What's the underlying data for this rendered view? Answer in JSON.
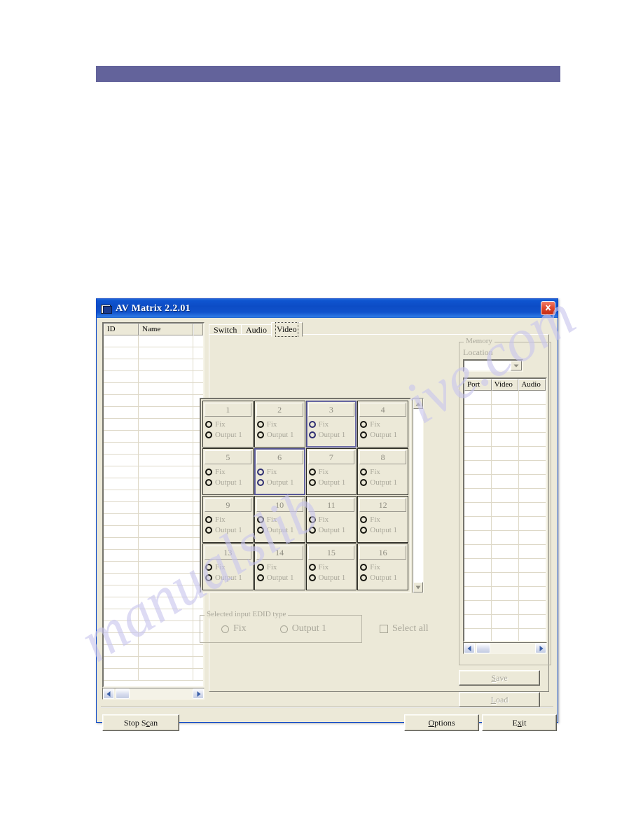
{
  "window": {
    "title": "AV Matrix 2.2.01",
    "icon": "app-window-icon",
    "close_label": "close-icon"
  },
  "device_list": {
    "columns": [
      "ID",
      "Name",
      ""
    ],
    "rows": [],
    "empty_row_count": 29,
    "scrollbar": {
      "left_arrow": "◄",
      "right_arrow": "►"
    }
  },
  "tabs": [
    {
      "label": "Switch",
      "active": false
    },
    {
      "label": "Audio",
      "active": false
    },
    {
      "label": "Video",
      "active": true
    }
  ],
  "ports": {
    "option_fix": "Fix",
    "option_output": "Output 1",
    "items": [
      {
        "number": "1",
        "selected": false
      },
      {
        "number": "2",
        "selected": false
      },
      {
        "number": "3",
        "selected": true
      },
      {
        "number": "4",
        "selected": false
      },
      {
        "number": "5",
        "selected": false
      },
      {
        "number": "6",
        "selected": true
      },
      {
        "number": "7",
        "selected": false
      },
      {
        "number": "8",
        "selected": false
      },
      {
        "number": "9",
        "selected": false
      },
      {
        "number": "10",
        "selected": false
      },
      {
        "number": "11",
        "selected": false
      },
      {
        "number": "12",
        "selected": false
      },
      {
        "number": "13",
        "selected": false
      },
      {
        "number": "14",
        "selected": false
      },
      {
        "number": "15",
        "selected": false
      },
      {
        "number": "16",
        "selected": false
      }
    ],
    "scrollbar": {
      "up_arrow": "▲",
      "down_arrow": "▼"
    }
  },
  "edid": {
    "group_label": "Selected input EDID type",
    "option_fix": "Fix",
    "option_output": "Output 1",
    "select_all_label": "Select all",
    "select_all_checked": false
  },
  "memory": {
    "group_label": "Memory",
    "location_label": "Location",
    "location_value": "",
    "location_placeholder": "",
    "columns": [
      "Port",
      "Video",
      "Audio"
    ],
    "rows": [],
    "empty_row_count": 18,
    "save_label": "Save",
    "save_mnemonic": "S",
    "save_rest": "ave",
    "load_label": "Load",
    "load_mnemonic": "L",
    "load_rest": "oad",
    "scrollbar": {
      "left_arrow": "◄",
      "right_arrow": "►"
    }
  },
  "footer": {
    "stop_scan_pre": "Stop S",
    "stop_scan_mnemonic": "c",
    "stop_scan_post": "an",
    "options_mnemonic": "O",
    "options_rest": "ptions",
    "exit_pre": "E",
    "exit_mnemonic": "x",
    "exit_post": "it"
  },
  "page": {
    "banner_color": "#63639b",
    "watermark_line_1": "manualslib",
    "watermark_line_2": "ive.com"
  },
  "colors": {
    "dialog_face": "#ece9d8",
    "titlebar_blue": "#0f55d0",
    "close_red": "#c32a12",
    "banner": "#63639b",
    "disabled_text": "#a9a79a",
    "watermark": "#c9c6ee"
  }
}
